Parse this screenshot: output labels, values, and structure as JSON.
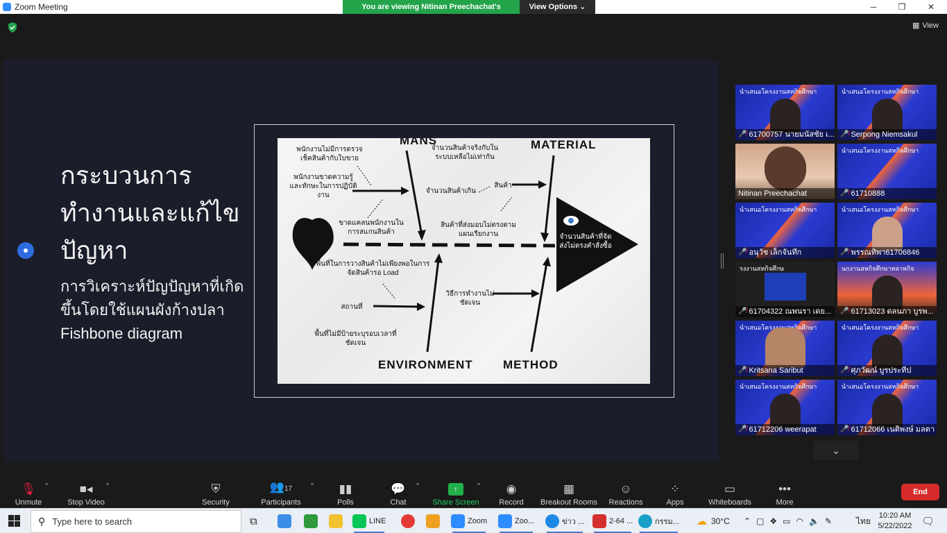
{
  "window": {
    "title": "Zoom Meeting",
    "banner_text": "You are viewing Nitinan Preechachat's screen",
    "view_options": "View Options ⌄",
    "minimize": "─",
    "restore": "❐",
    "close": "✕"
  },
  "meeting": {
    "view_label": "View",
    "slide": {
      "title": "กระบวนการทำงานและแก้ไขปัญหา",
      "subtitle_line1": "การวิเคราะห์ปัญปัญหาที่เกิดขึ้นโดยใช้แผนผังก้างปลา",
      "subtitle_line2": "Fishbone diagram"
    },
    "fishbone": {
      "cat_man": "MANS",
      "cat_material": "MATERIAL",
      "cat_environment": "ENVIRONMENT",
      "cat_method": "METHOD",
      "head_text": "จำนวนสินค้าที่จัดส่งไม่ตรงคำสั่งซื้อ",
      "c1": "พนักงานไม่มีการตรวจเช็คสินค้ากับใบขาย",
      "c2": "พนักงานขาดความรู้และทักษะในการปฏิบัติงาน",
      "c3": "ขาดแคลนพนักงานในการสแกนสินค้า",
      "c4": "จำนวนสินค้าจริงกับในระบบเหลือไม่เท่ากัน",
      "c5": "จำนวนสินค้าเกิน",
      "c6": "สินค้า",
      "c7": "สินค้าที่ส่งมอบไม่ตรงตามแผนเรียกงาน",
      "c8": "พื้นที่ในการวางสินค้าไม่เพียงพอในการจัดสินค้ารอ Load",
      "c9": "สถานที่",
      "c10": "พื้นที่ไม่มีป้ายระบุรอบเวลาที่ชัดเจน",
      "c11": "วิธีการทำงานไม่ชัดเจน"
    }
  },
  "gallery": {
    "participants": [
      {
        "name": "61700757 นายมนัสชัย เ...",
        "banner": "นำเสนอโครงงานสหกิจศึกษา",
        "style": "banner"
      },
      {
        "name": "Serpong Niemsakul",
        "banner": "นำเสนอโครงงานสหกิจศึกษา",
        "style": "banner"
      },
      {
        "name": "Nitinan Preechachat",
        "banner": "",
        "style": "face"
      },
      {
        "name": "61710888",
        "banner": "นำเสนอโครงงานสหกิจศึกษา",
        "style": "banner"
      },
      {
        "name": "อนุวัช เล็กจันทึก",
        "banner": "นำเสนอโครงงานสหกิจศึกษา",
        "style": "banner"
      },
      {
        "name": "พรรณทิพา61706846",
        "banner": "นำเสนอโครงงานสหกิจศึกษา",
        "style": "banner"
      },
      {
        "name": "61704322 ณพนรา เดย...",
        "banner": "รงงานสหกิจศึกษ",
        "style": "dark"
      },
      {
        "name": "61713023 ดลนภา บูรพ...",
        "banner": "นกงานสหกิจศึกษาหลาหกิจ",
        "style": "banner"
      },
      {
        "name": "Kritsana Saribut",
        "banner": "นำเสนอโครงงานสหกิจศึกษา",
        "style": "banner"
      },
      {
        "name": "ศุภวัฒน์ บูรประทีป",
        "banner": "นำเสนอโครงงานสหกิจศึกษา",
        "style": "banner"
      },
      {
        "name": "61712206 weerapat",
        "banner": "นำเสนอโครงงานสหกิจศึกษา",
        "style": "banner"
      },
      {
        "name": "61712066 เนติพงษ์ มลตา",
        "banner": "นำเสนอโครงงานสหกิจศึกษา",
        "style": "banner"
      }
    ],
    "active_index": 2,
    "scroll_down": "⌄"
  },
  "toolbar": {
    "unmute": "Unmute",
    "stop_video": "Stop Video",
    "security": "Security",
    "participants": "Participants",
    "participants_count": "17",
    "polls": "Polls",
    "chat": "Chat",
    "share_screen": "Share Screen",
    "record": "Record",
    "breakout": "Breakout Rooms",
    "reactions": "Reactions",
    "apps": "Apps",
    "whiteboards": "Whiteboards",
    "more": "More",
    "end": "End"
  },
  "taskbar": {
    "search_placeholder": "Type here to search",
    "apps": [
      "LINE",
      "Zoom",
      "Zoo...",
      "ข่าว ...",
      "2-64 ...",
      "กรรม..."
    ],
    "temperature": "30°C",
    "lang": "ไทย",
    "time": "10:20 AM",
    "date": "5/22/2022"
  }
}
